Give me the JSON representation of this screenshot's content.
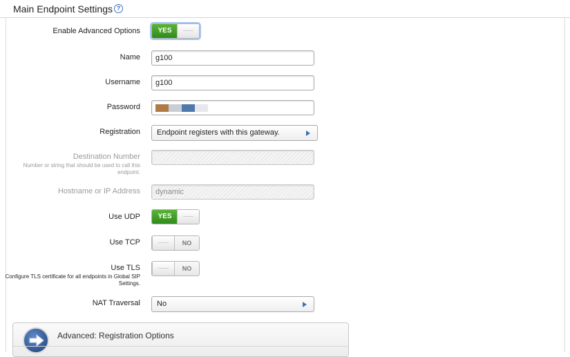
{
  "header": {
    "title": "Main Endpoint Settings",
    "help_glyph": "?",
    "help_icon": "question-circle-icon"
  },
  "form": {
    "enable_advanced": {
      "label": "Enable Advanced Options",
      "state": "YES",
      "on_text": "YES"
    },
    "name": {
      "label": "Name",
      "value": "g100"
    },
    "username": {
      "label": "Username",
      "value": "g100"
    },
    "password": {
      "label": "Password",
      "value_masked": true
    },
    "registration": {
      "label": "Registration",
      "value": "Endpoint registers with this gateway."
    },
    "destination_number": {
      "label": "Destination Number",
      "help": "Number or string that should be used to call this endpoint.",
      "value": "",
      "disabled": true
    },
    "hostname": {
      "label": "Hostname or IP Address",
      "value": "dynamic",
      "disabled": true
    },
    "use_udp": {
      "label": "Use UDP",
      "state": "YES",
      "on_text": "YES"
    },
    "use_tcp": {
      "label": "Use TCP",
      "state": "NO",
      "off_text": "NO"
    },
    "use_tls": {
      "label": "Use TLS",
      "help": "Configure TLS certificate for all endpoints in Global SIP Settings.",
      "state": "NO",
      "off_text": "NO"
    },
    "nat_traversal": {
      "label": "NAT Traversal",
      "value": "No"
    }
  },
  "advanced_panel": {
    "title": "Advanced: Registration Options",
    "icon": "arrow-right-circle-icon"
  },
  "colors": {
    "toggle_on": "#3f9d2a",
    "accent": "#3a73b8",
    "password_mask": [
      "#b07a45",
      "#c9ced6",
      "#4d79ac",
      "#e6e8ec"
    ]
  }
}
